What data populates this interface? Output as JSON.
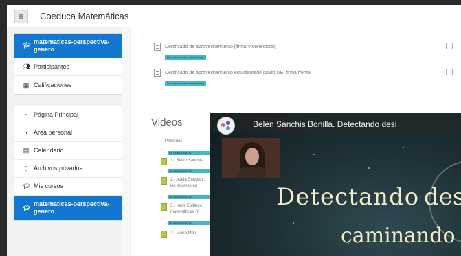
{
  "app": {
    "title": "Coeduca Matemáticas"
  },
  "sidebar": {
    "course_block": [
      {
        "label": "matematicas-perspectiva-genero",
        "icon": "graduation-cap-icon"
      },
      {
        "label": "Participantes",
        "icon": "users-icon"
      },
      {
        "label": "Calificaciones",
        "icon": "table-icon"
      }
    ],
    "main_block": [
      {
        "label": "Página Principal",
        "icon": "home-icon"
      },
      {
        "label": "Área personal",
        "icon": "dashboard-icon"
      },
      {
        "label": "Calendario",
        "icon": "calendar-icon"
      },
      {
        "label": "Archivos privados",
        "icon": "file-icon"
      },
      {
        "label": "Mis cursos",
        "icon": "graduation-cap-icon"
      },
      {
        "label": "matematicas-perspectiva-genero",
        "icon": "graduation-cap-icon"
      }
    ]
  },
  "main": {
    "activities": [
      {
        "name": "Certificado de aprovechamiento (firma Vicerrectoral)",
        "restriction": "No mostrado a los estudiantes"
      },
      {
        "name": "Certificado de aprovechamiento estudiantado grado UE, firma frente",
        "restriction": "No mostrado a los estudiantes"
      }
    ],
    "section_title": "Videos",
    "video_items": [
      {
        "name": "Ponentes",
        "restriction": "No mostrado a los"
      },
      {
        "name": "1.- Belén Sanchis",
        "restriction": "No mostrado a los"
      },
      {
        "name": "2.- Adela Salvador, las mujeres en",
        "restriction": "No mostrado a los"
      },
      {
        "name": "3.- Irene Epifanio, matemáticas. Y",
        "restriction": "No mostrado a los"
      },
      {
        "name": "4.- María Mari",
        "restriction": ""
      }
    ]
  },
  "video": {
    "title": "Belén Sanchis Bonilla. Detectando desi",
    "slide_line1": "Detectando",
    "slide_line1b": "des",
    "slide_line2": "caminando"
  },
  "colors": {
    "accent": "#1177d1",
    "restrict_badge": "#47b4c8"
  }
}
